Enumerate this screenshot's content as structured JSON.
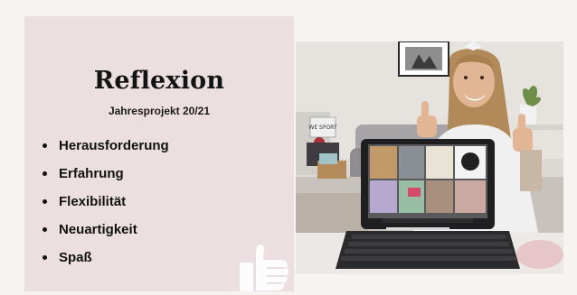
{
  "slide": {
    "title": "Reflexion",
    "subtitle": "Jahresprojekt 20/21",
    "bullets": [
      {
        "label": "Herausforderung"
      },
      {
        "label": "Erfahrung"
      },
      {
        "label": "Flexibilität"
      },
      {
        "label": "Neuartigkeit"
      },
      {
        "label": "Spaß"
      }
    ]
  },
  "photo": {
    "sign_text": "WE SPORT"
  },
  "colors": {
    "left_panel": "#ecdfe1",
    "background": "#f6f3f1",
    "text": "#111111"
  }
}
